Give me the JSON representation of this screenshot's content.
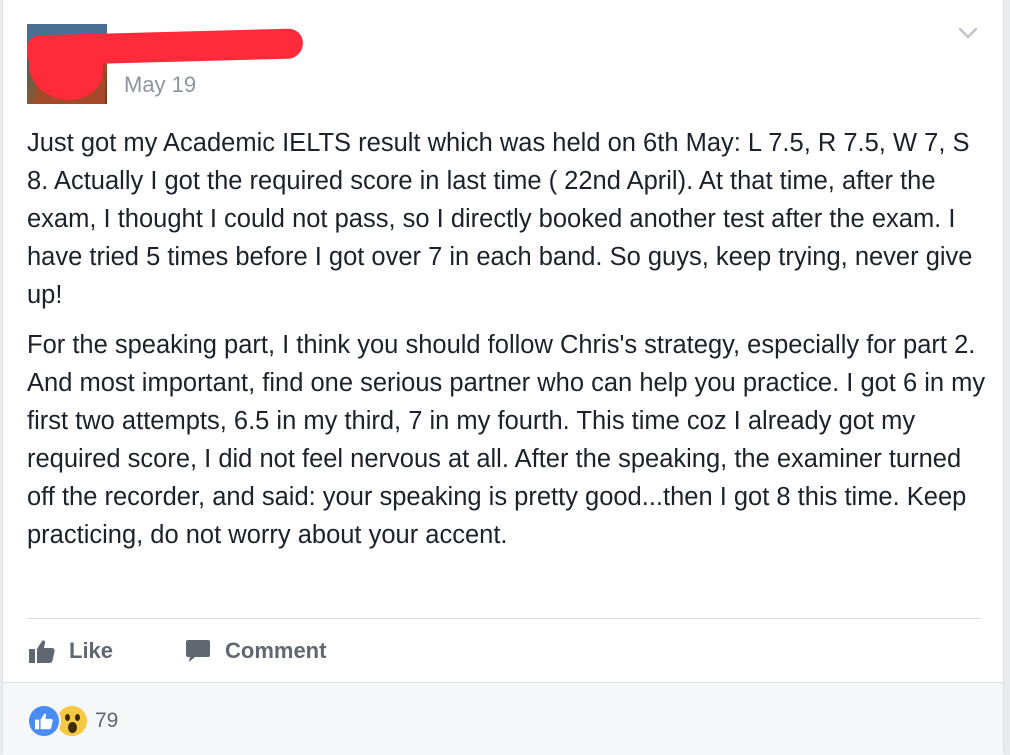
{
  "post": {
    "date": "May 19",
    "paragraphs": [
      "Just got my Academic IELTS result which was held on 6th May: L 7.5, R 7.5, W 7, S 8. Actually I got the required score in last time ( 22nd April). At that time, after the exam, I thought I could not pass, so I directly booked another test after the exam. I have tried 5 times before I got over 7 in each band. So guys, keep trying, never give up!",
      "For the speaking part, I think you should follow Chris's strategy, especially for part 2. And most important, find one serious partner who can help you practice. I got 6 in my first two attempts, 6.5 in my third, 7 in my fourth. This time coz I already got my required score, I did not feel nervous at all. After the speaking, the examiner turned off the recorder, and said: your speaking is pretty good...then I got 8 this time. Keep practicing, do not worry about your accent."
    ]
  },
  "actions": {
    "like_label": "Like",
    "comment_label": "Comment"
  },
  "reactions": {
    "count": "79",
    "icons": [
      "like-reaction-icon",
      "wow-reaction-icon"
    ]
  },
  "colors": {
    "accent": "#4a8cf7",
    "text": "#1d2129",
    "muted": "#90949c",
    "redaction": "#ff2a3a"
  }
}
